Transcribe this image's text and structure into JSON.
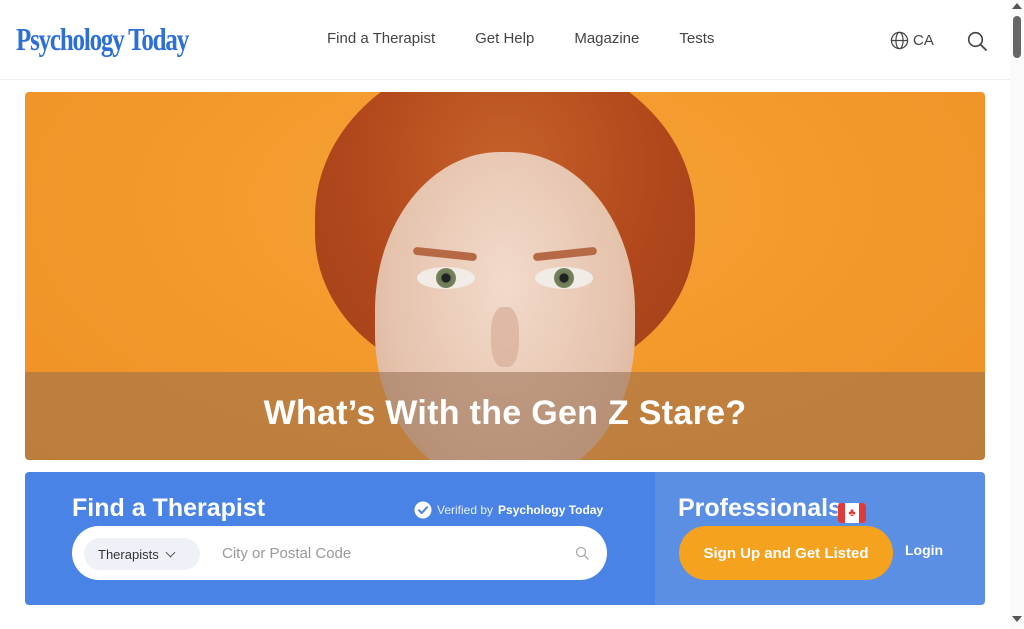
{
  "header": {
    "logo_text": "Psychology Today",
    "nav": [
      {
        "label": "Find a Therapist"
      },
      {
        "label": "Get Help"
      },
      {
        "label": "Magazine"
      },
      {
        "label": "Tests"
      }
    ],
    "locale": "CA",
    "icons": {
      "locale": "globe-icon",
      "search": "search-icon"
    }
  },
  "hero": {
    "title": "What’s With the Gen Z Stare?"
  },
  "finder": {
    "title": "Find a Therapist",
    "verified_prefix": "Verified by",
    "verified_brand": "Psychology Today",
    "type_select": "Therapists",
    "location_placeholder": "City or Postal Code"
  },
  "professionals": {
    "title": "Professionals",
    "signup_label": "Sign Up and Get Listed",
    "login_label": "Login"
  },
  "colors": {
    "brand_blue": "#2d6fd6",
    "finder_blue": "#4a83e6",
    "pros_blue": "#5b8fe4",
    "signup_orange": "#f5a21e",
    "hero_orange": "#f39a2c"
  }
}
